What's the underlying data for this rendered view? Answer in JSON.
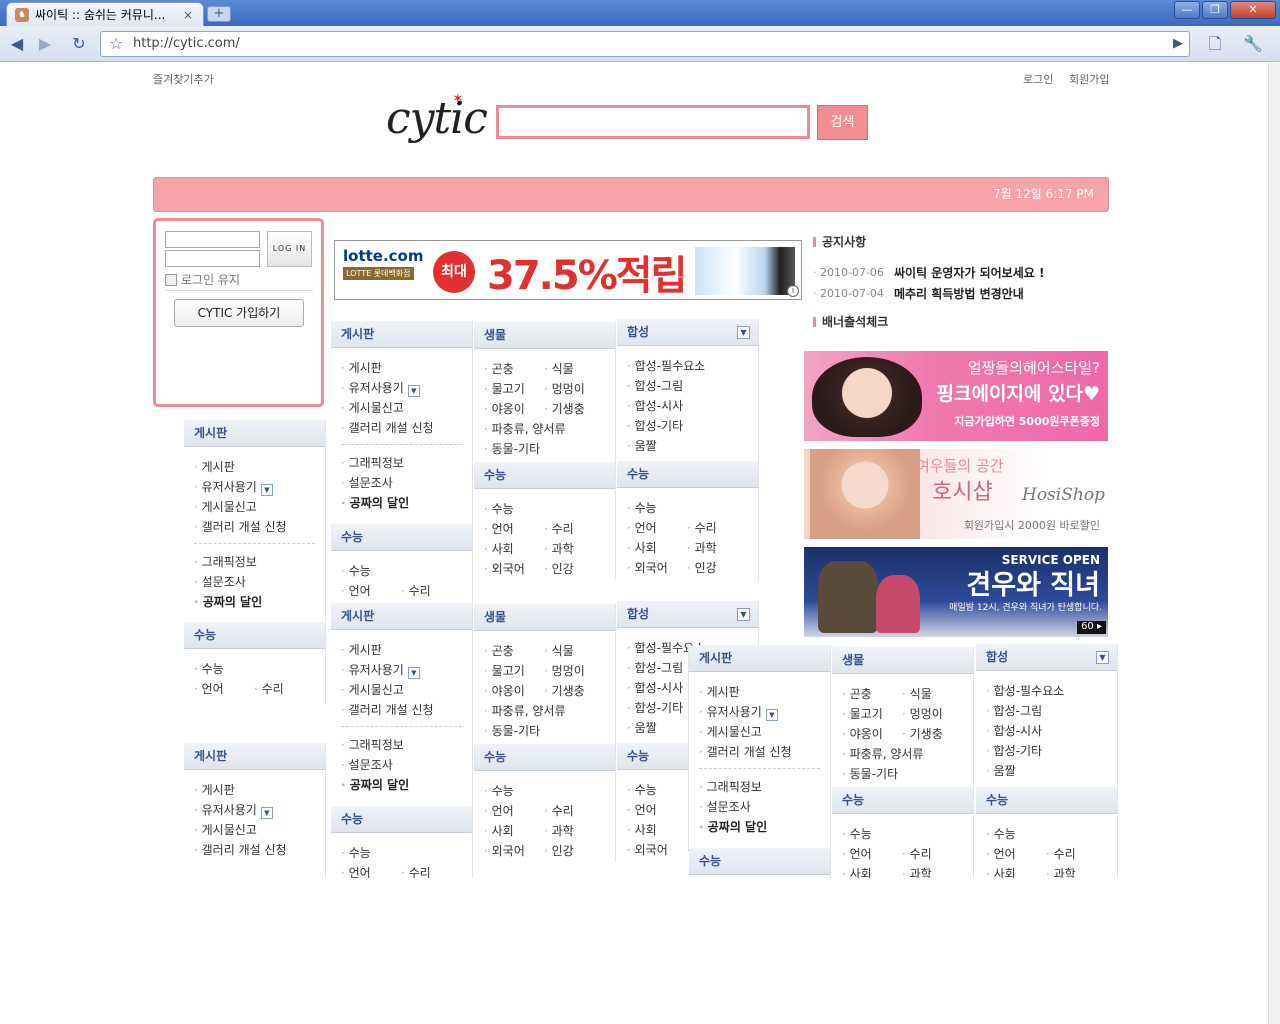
{
  "browser": {
    "tab_title": "싸이틱 :: 숨쉬는 커뮤니...",
    "tab_close": "×",
    "new_tab": "+",
    "url": "http://cytic.com/",
    "win_min": "—",
    "win_max": "❐",
    "win_close": "✕"
  },
  "header": {
    "bookmark": "즐겨찾기추가",
    "login": "로그인",
    "signup": "회원가입",
    "logo": "cytic",
    "search_button": "검색",
    "datetime": "7월 12일 6:17 PM"
  },
  "login_box": {
    "login_button": "LOG IN",
    "keep_login": "로그인 유지",
    "join_button": "CYTIC 가입하기"
  },
  "banner": {
    "brand": "lotte.com",
    "brand_sub": "LOTTE 롯데백화점",
    "badge": "최대",
    "headline": "37.5%적립",
    "info": "i"
  },
  "notice": {
    "title": "공지사항",
    "items": [
      {
        "date": "2010-07-06",
        "text": "싸이틱 운영자가 되어보세요 !"
      },
      {
        "date": "2010-07-04",
        "text": "메추리 획득방법 변경안내"
      }
    ]
  },
  "attendance": {
    "title": "배너출석체크"
  },
  "ads": [
    {
      "line1": "얼짱들의헤어스타일?",
      "line2": "핑크에이지에 있다♥",
      "line3": "지금가입하면 5000원쿠폰증정"
    },
    {
      "line1": "여우들의 공간",
      "line2": "호시샵",
      "line3": "회원가입시 2000원 바로할인",
      "logo": "HosiShop"
    },
    {
      "line1": "SERVICE OPEN",
      "line2": "견우와 직녀",
      "line3": "매일밤 12시, 견우와 직녀가 탄생합니다.",
      "badge": "60 ▸"
    }
  ],
  "widgets": {
    "board": {
      "title": "게시판",
      "items": [
        "게시판",
        "유저사용기",
        "게시물신고",
        "갤러리 개설 신청"
      ],
      "items2": [
        "그래픽정보",
        "설문조사",
        "공짜의 달인"
      ]
    },
    "life": {
      "title": "생물",
      "left": [
        "곤충",
        "물고기",
        "야옹이",
        "파충류, 양서류",
        "동물-기타"
      ],
      "right": [
        "식물",
        "멍멍이",
        "기생충"
      ]
    },
    "synth": {
      "title": "합성",
      "items": [
        "합성-필수요소",
        "합성-그림",
        "합성-시사",
        "합성-기타",
        "움짤"
      ]
    },
    "suneung": {
      "title": "수능",
      "first": "수능",
      "left": [
        "언어",
        "사회",
        "외국어"
      ],
      "right": [
        "수리",
        "과학",
        "인강"
      ]
    }
  }
}
